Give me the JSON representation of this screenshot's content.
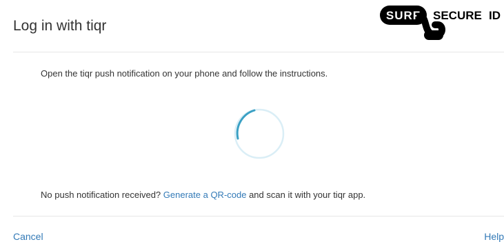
{
  "header": {
    "title": "Log in with tiqr",
    "logo_text": "SURF SECUREID"
  },
  "main": {
    "instruction": "Open the tiqr push notification on your phone and follow the instructions.",
    "spinner": "loading-spinner",
    "fallback_prefix": "No push notification received? ",
    "fallback_link": "Generate a QR-code",
    "fallback_suffix": " and scan it with your tiqr app."
  },
  "footer": {
    "cancel_label": "Cancel",
    "help_label": "Help"
  },
  "colors": {
    "link": "#337ab7",
    "text": "#333333",
    "spinner_track": "#daeef6",
    "spinner_arc": "#3aa0c4"
  }
}
